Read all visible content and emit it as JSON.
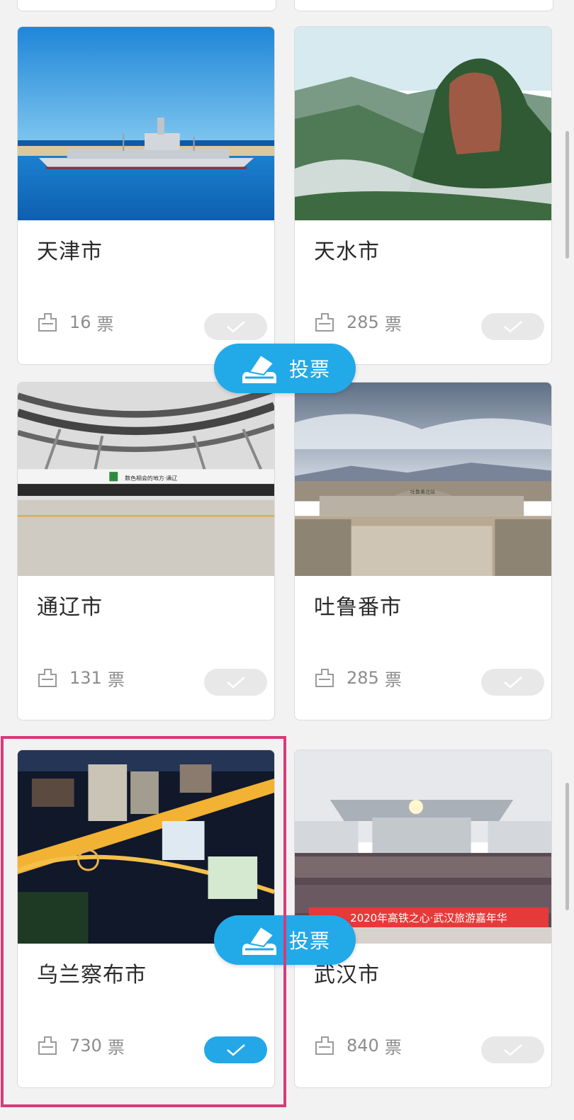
{
  "vote_button": {
    "label": "投票"
  },
  "cards": [
    {
      "city": "天津市",
      "votes": "16",
      "unit": "票",
      "selected": false
    },
    {
      "city": "天水市",
      "votes": "285",
      "unit": "票",
      "selected": false
    },
    {
      "city": "通辽市",
      "votes": "131",
      "unit": "票",
      "selected": false
    },
    {
      "city": "吐鲁番市",
      "votes": "285",
      "unit": "票",
      "selected": false
    },
    {
      "city": "乌兰察布市",
      "votes": "730",
      "unit": "票",
      "selected": true
    },
    {
      "city": "武汉市",
      "votes": "840",
      "unit": "票",
      "selected": false
    }
  ],
  "photos": {
    "tongliao_sign": "数色相会的地方·通辽",
    "turpan_sign": "吐鲁番北站",
    "wuhan_banner": "2020年高铁之心·武汉旅游嘉年华"
  },
  "colors": {
    "accent": "#23a7e6",
    "highlight": "#d93a78",
    "unselected": "#e8e8e8"
  },
  "icons": {
    "vote": "ballot-box-icon",
    "ticket": "ticket-icon",
    "check": "checkmark-icon"
  }
}
